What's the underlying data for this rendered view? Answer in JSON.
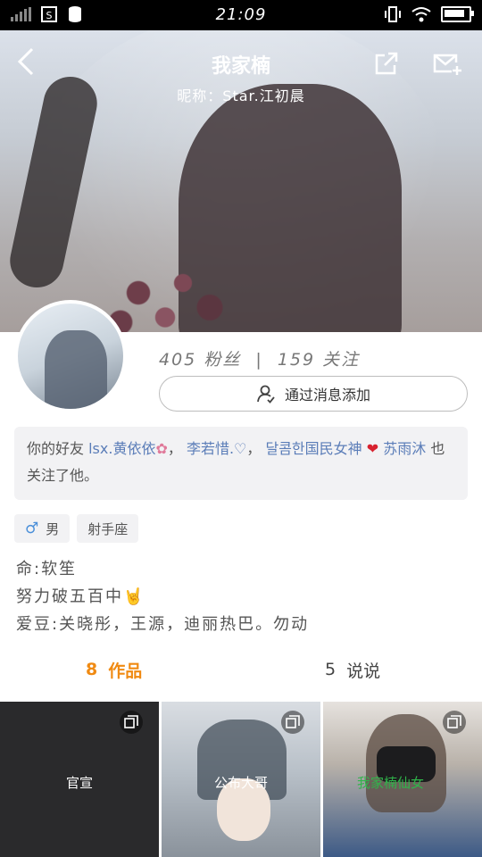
{
  "status_bar": {
    "time": "21:09"
  },
  "header": {
    "title": "我家楠",
    "nickname": "昵称：Star.江初晨"
  },
  "profile": {
    "fans_count": "405",
    "fans_label": "粉丝",
    "follow_count": "159",
    "follow_label": "关注",
    "separator": "|",
    "add_button_label": "通过消息添加"
  },
  "friends": {
    "prefix": "你的好友",
    "friend_1": "lsx.黄依依",
    "friend_2": "李若惜.♡",
    "friend_3": "달콤한国民女神",
    "friend_4": "苏雨沐",
    "suffix": "也关注了他。"
  },
  "tags": {
    "gender": "男",
    "zodiac": "射手座"
  },
  "bio": {
    "line1": "命:软笙",
    "line2": "努力破五百中",
    "line3": "爱豆:关晓彤，王源，迪丽热巴。勿动"
  },
  "tabs": {
    "works_count": "8",
    "works_label": "作品",
    "posts_count": "5",
    "posts_label": "说说"
  },
  "grid": [
    {
      "label": "官宣"
    },
    {
      "label": "公布大哥"
    },
    {
      "label": "我家楠仙女"
    }
  ],
  "colors": {
    "accent": "#f08a12",
    "link": "#5b7db8",
    "male": "#4a8fd9"
  }
}
